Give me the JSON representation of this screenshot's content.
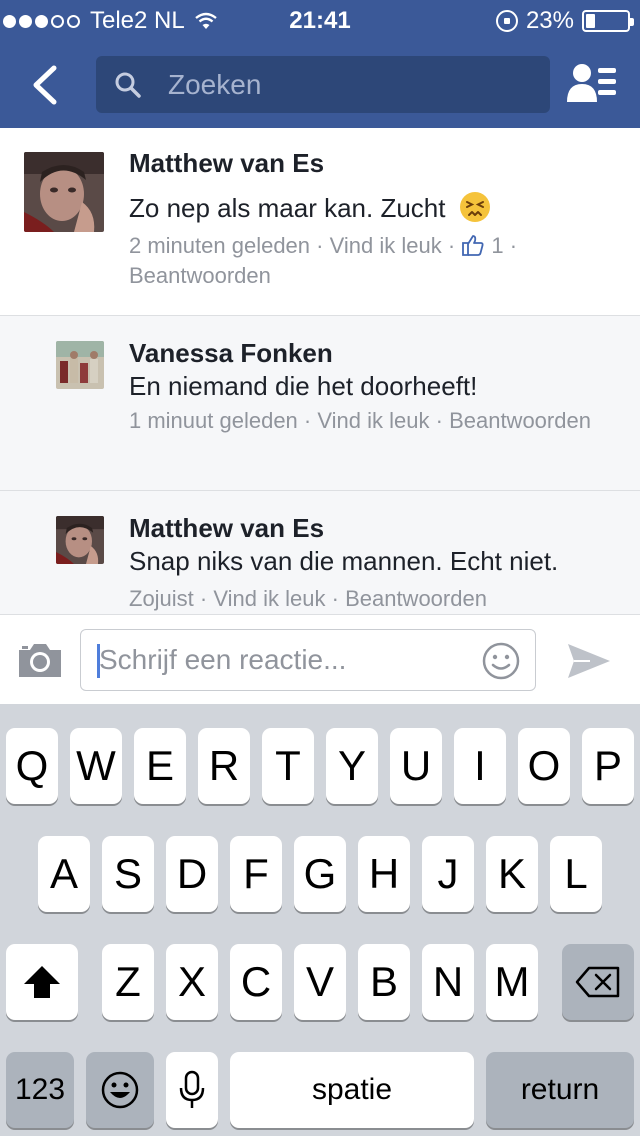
{
  "status_bar": {
    "carrier": "Tele2 NL",
    "time": "21:41",
    "battery": "23%",
    "battery_level": 0.23,
    "signal_bars": 3,
    "signal_max": 5
  },
  "nav": {
    "search_placeholder": "Zoeken",
    "icons": [
      "back-chevron-icon",
      "search-icon",
      "friend-requests-icon"
    ],
    "colors": {
      "bar": "#3b5998",
      "search_field": "#2d4778"
    }
  },
  "comments": [
    {
      "author": "Matthew van Es",
      "text": "Zo nep als maar kan. Zucht",
      "emoji": "persevering-face-emoji",
      "time": "2 minuten geleden",
      "like_label": "Vind ik leuk",
      "like_count": "1",
      "reply_label": "Beantwoorden"
    },
    {
      "author": "Vanessa Fonken",
      "text": "En niemand die het doorheeft!",
      "time": "1 minuut geleden",
      "like_label": "Vind ik leuk",
      "reply_label": "Beantwoorden"
    },
    {
      "author": "Matthew van Es",
      "text": "Snap niks van die mannen. Echt niet.",
      "time": "Zojuist",
      "like_label": "Vind ik leuk",
      "reply_label": "Beantwoorden"
    }
  ],
  "separator": "·",
  "composer": {
    "placeholder": "Schrijf een reactie...",
    "icons": [
      "camera-icon",
      "emoji-icon",
      "send-icon"
    ]
  },
  "keyboard": {
    "row1": [
      "Q",
      "W",
      "E",
      "R",
      "T",
      "Y",
      "U",
      "I",
      "O",
      "P"
    ],
    "row2": [
      "A",
      "S",
      "D",
      "F",
      "G",
      "H",
      "J",
      "K",
      "L"
    ],
    "row3": [
      "Z",
      "X",
      "C",
      "V",
      "B",
      "N",
      "M"
    ],
    "numbers_label": "123",
    "space_label": "spatie",
    "return_label": "return",
    "icons": [
      "shift-icon",
      "backspace-icon",
      "emoji-keyboard-icon",
      "microphone-icon"
    ]
  }
}
